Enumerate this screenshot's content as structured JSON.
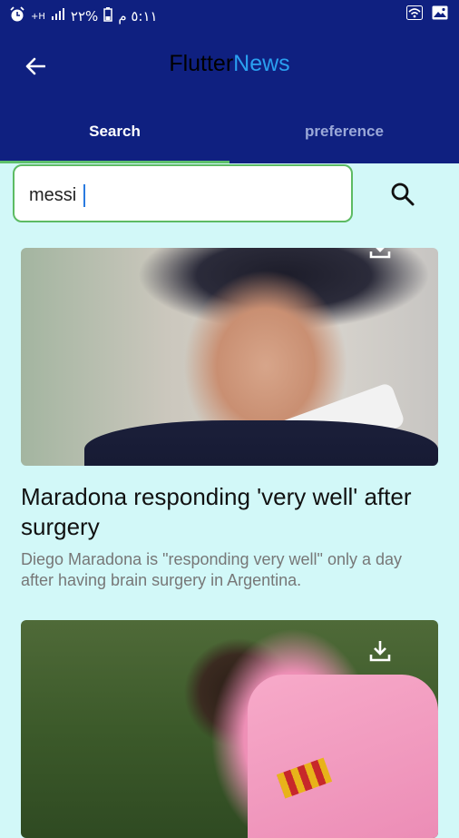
{
  "status_bar": {
    "time": "٥:١١ م",
    "battery": "%٢٢",
    "network": "H+"
  },
  "app_bar": {
    "title_part1": "Flutter",
    "title_part2": "News",
    "title_color1": "#000000",
    "title_color2": "#2aa0f0",
    "background": "#0f2080"
  },
  "tabs": [
    {
      "label": "Search",
      "active": true
    },
    {
      "label": "preference",
      "active": false
    }
  ],
  "search": {
    "value": "messi",
    "placeholder": ""
  },
  "articles": [
    {
      "title": "Maradona responding 'very well' after surgery",
      "description": "Diego Maradona is \"responding very well\" only a day after having brain surgery in Argentina.",
      "image": "maradona-photo"
    },
    {
      "title": "",
      "description": "",
      "image": "messi-photo"
    }
  ],
  "colors": {
    "accent_green": "#5dbb63",
    "page_background": "#d2f8f8"
  }
}
